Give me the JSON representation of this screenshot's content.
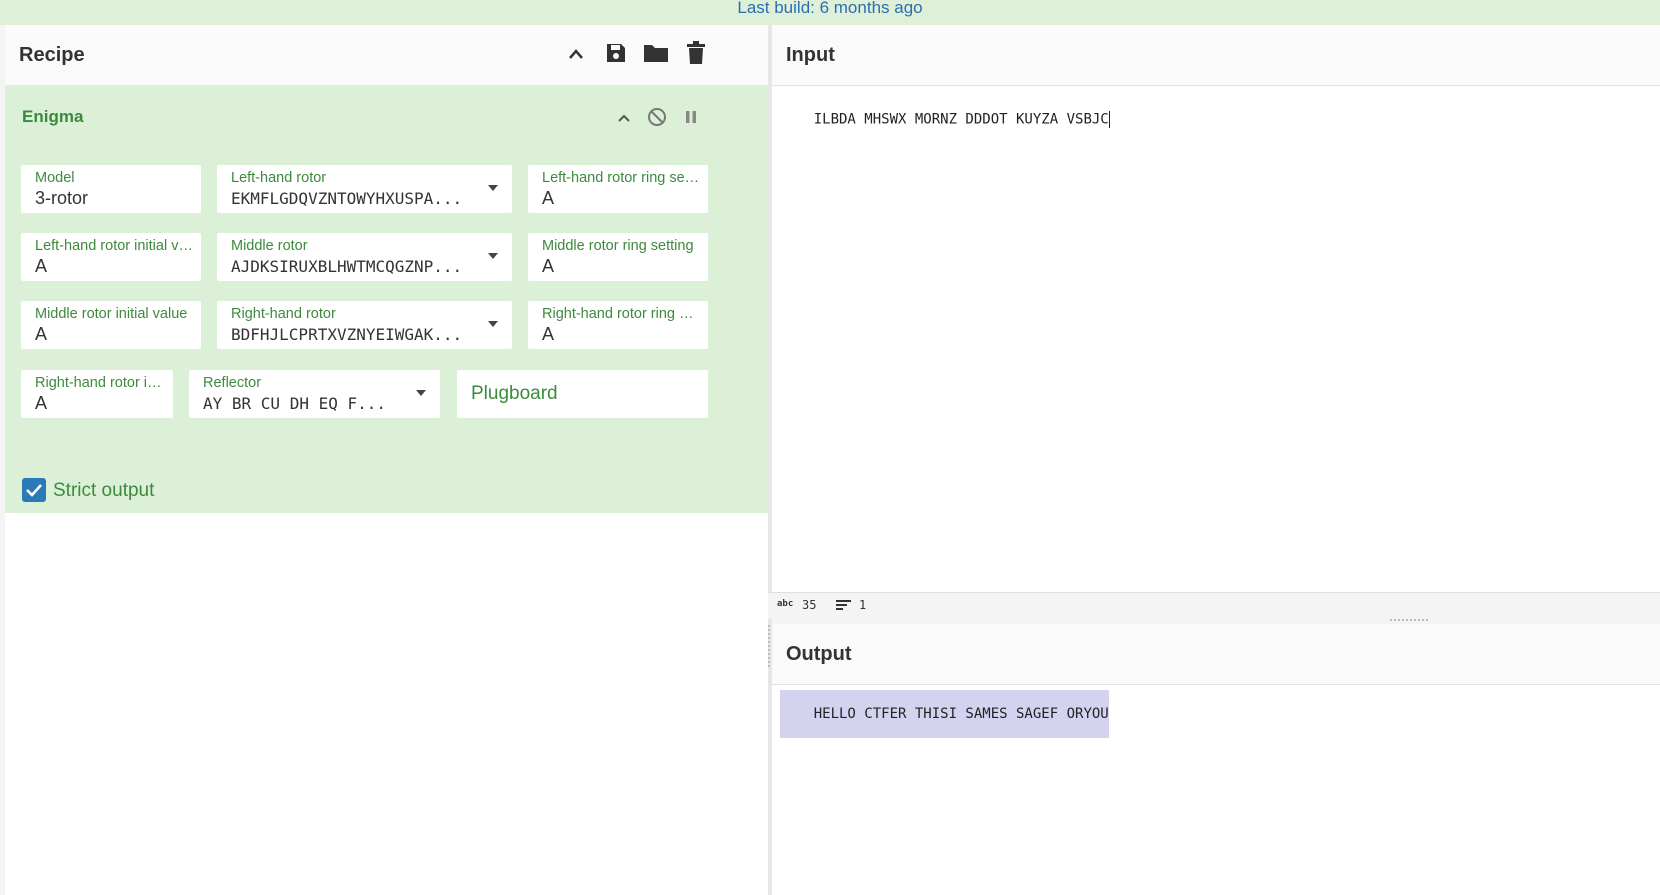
{
  "banner": {
    "text": "Last build: 6 months ago"
  },
  "recipe": {
    "title": "Recipe",
    "icons": [
      "chevron-up-icon",
      "save-icon",
      "folder-icon",
      "trash-icon"
    ]
  },
  "operation": {
    "title": "Enigma",
    "icons": [
      "chevron-up-icon",
      "disable-icon",
      "pause-icon"
    ],
    "fields": {
      "model": {
        "label": "Model",
        "value": "3-rotor"
      },
      "left_rotor": {
        "label": "Left-hand rotor",
        "value": "EKMFLGDQVZNTOWYHXUSPA..."
      },
      "left_ring": {
        "label": "Left-hand rotor ring sett...",
        "value": "A"
      },
      "left_initial": {
        "label": "Left-hand rotor initial va...",
        "value": "A"
      },
      "middle_rotor": {
        "label": "Middle rotor",
        "value": "AJDKSIRUXBLHWTMCQGZNP..."
      },
      "middle_ring": {
        "label": "Middle rotor ring setting",
        "value": "A"
      },
      "middle_initial": {
        "label": "Middle rotor initial value",
        "value": "A"
      },
      "right_rotor": {
        "label": "Right-hand rotor",
        "value": "BDFHJLCPRTXVZNYEIWGAK..."
      },
      "right_ring": {
        "label": "Right-hand rotor ring se...",
        "value": "A"
      },
      "right_initial": {
        "label": "Right-hand rotor ini...",
        "value": "A"
      },
      "reflector": {
        "label": "Reflector",
        "value": "AY BR CU DH EQ F..."
      },
      "plugboard": {
        "placeholder": "Plugboard"
      }
    },
    "strict_output": {
      "label": "Strict output",
      "checked": true
    }
  },
  "input": {
    "title": "Input",
    "text": "ILBDA MHSWX MORNZ DDDOT KUYZA VSBJC"
  },
  "status": {
    "char_count_icon": "abc",
    "char_count": "35",
    "line_count": "1"
  },
  "output": {
    "title": "Output",
    "text": "HELLO CTFER THISI SAMES SAGEF ORYOU"
  },
  "colors": {
    "banner_bg": "#dff0d8",
    "operation_bg": "#dbf0d6",
    "accent_green": "#3d8a3d",
    "checkbox_blue": "#2a7ab8",
    "output_highlight": "#d3d3ef"
  }
}
